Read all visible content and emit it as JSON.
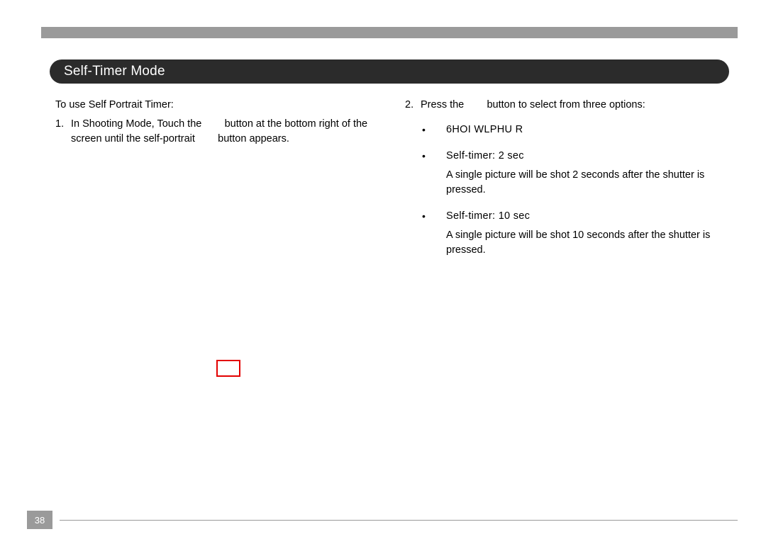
{
  "heading": "Self-Timer Mode",
  "left": {
    "lead": "To use Self Portrait Timer:",
    "step1_num": "1.",
    "step1_text_a": "In Shooting Mode, Touch the ",
    "step1_text_b": "button at the bottom right of the screen until the self-portrait ",
    "step1_text_c": "button appears."
  },
  "right": {
    "step2_num": "2.",
    "step2_text_a": "Press the ",
    "step2_text_b": "button to select from three options:",
    "opt1_title": "6HOI WLPHU  R",
    "opt2_title": "Self-timer:  2 sec",
    "opt2_desc": "A single picture will be shot 2 seconds after the shutter is pressed.",
    "opt3_title": "Self-timer:  10 sec",
    "opt3_desc": "A single picture will be shot 10 seconds after the shutter is pressed."
  },
  "page_number": "38",
  "dot": "•"
}
